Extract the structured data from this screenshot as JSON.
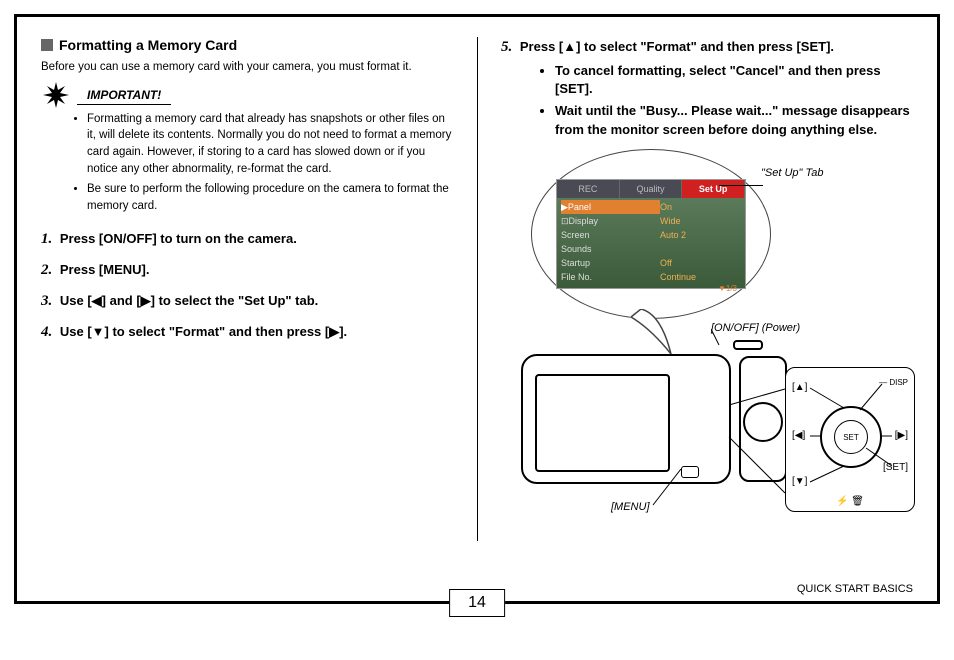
{
  "pageNumber": "14",
  "footerSection": "QUICK START BASICS",
  "left": {
    "sectionTitle": "Formatting a Memory Card",
    "intro": "Before you can use a memory card with your camera, you must format it.",
    "importantLabel": "IMPORTANT!",
    "importantItems": [
      "Formatting a memory card that already has snapshots or other files on it, will delete its contents. Normally you do not need to format a memory card again. However, if storing to a card has slowed down or if you notice any other abnormality, re-format the card.",
      "Be sure to perform the following procedure on the camera to format the memory card."
    ],
    "steps": {
      "s1": "Press [ON/OFF] to turn on the camera.",
      "s2": "Press [MENU].",
      "s3": "Use [◀] and [▶] to select the \"Set Up\" tab.",
      "s4": "Use [▼] to select \"Format\" and then press [▶]."
    }
  },
  "right": {
    "step5": "Press [▲] to select \"Format\" and then press [SET].",
    "subItems": [
      "To cancel formatting, select \"Cancel\" and then press [SET].",
      "Wait until the \"Busy... Please wait...\" message disappears from the monitor screen before doing anything else."
    ],
    "labels": {
      "setupTab": "\"Set Up\" Tab",
      "power": "[ON/OFF] (Power)",
      "menu": "[MENU]",
      "disp": "DISP",
      "set": "[SET]",
      "up": "[▲]",
      "down": "[▼]",
      "left": "[◀]",
      "right": "[▶]",
      "setCenter": "SET"
    },
    "menuScreen": {
      "tabs": [
        "REC",
        "Quality",
        "Set Up"
      ],
      "rows": [
        {
          "k": "▶Panel",
          "v": "On"
        },
        {
          "k": "⊡Display",
          "v": "Wide"
        },
        {
          "k": "Screen",
          "v": "Auto 2"
        },
        {
          "k": "Sounds",
          "v": ""
        },
        {
          "k": "Startup",
          "v": "Off"
        },
        {
          "k": "File No.",
          "v": "Continue"
        }
      ],
      "pager": "▼1/3"
    }
  }
}
